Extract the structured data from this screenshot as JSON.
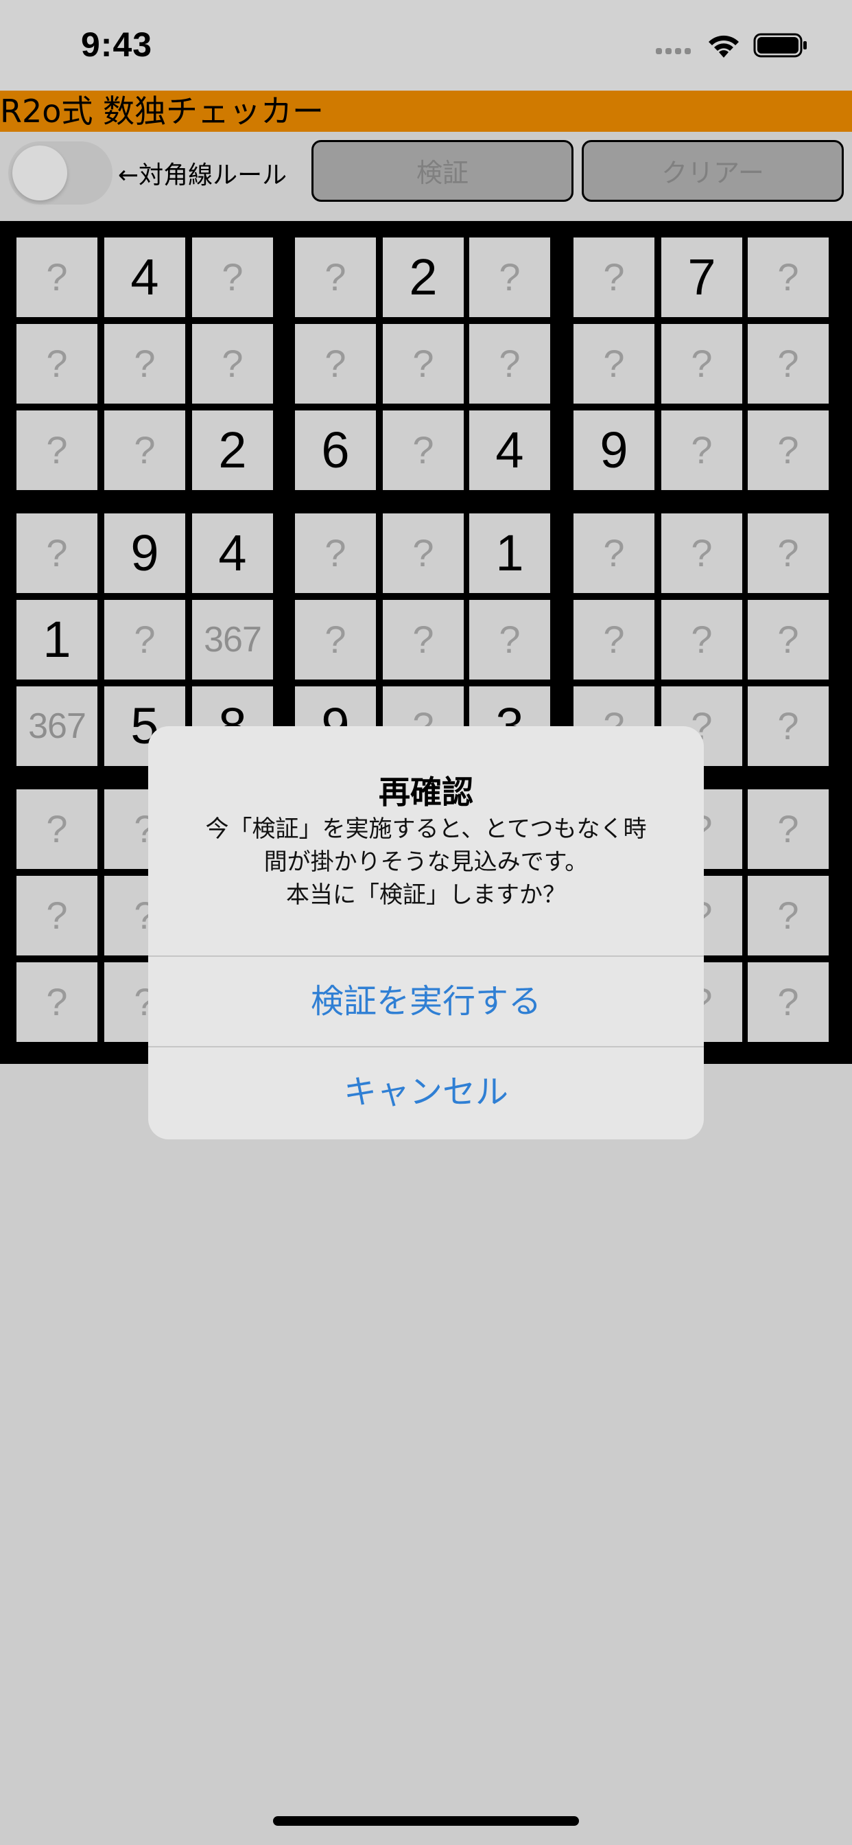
{
  "status_bar": {
    "time": "9:43"
  },
  "header": {
    "title": "R2o式 数独チェッカー"
  },
  "toolbar": {
    "diagonal_label": "←対角線ルール",
    "verify_label": "検証",
    "clear_label": "クリアー"
  },
  "grid": {
    "rows": [
      [
        "?",
        "4",
        "?",
        "?",
        "2",
        "?",
        "?",
        "7",
        "?"
      ],
      [
        "?",
        "?",
        "?",
        "?",
        "?",
        "?",
        "?",
        "?",
        "?"
      ],
      [
        "?",
        "?",
        "2",
        "6",
        "?",
        "4",
        "9",
        "?",
        "?"
      ],
      [
        "?",
        "9",
        "4",
        "?",
        "?",
        "1",
        "?",
        "?",
        "?"
      ],
      [
        "1",
        "?",
        "367",
        "?",
        "?",
        "?",
        "?",
        "?",
        "?"
      ],
      [
        "367",
        "5",
        "8",
        "9",
        "?",
        "3",
        "?",
        "?",
        "?"
      ],
      [
        "?",
        "?",
        "",
        "",
        "",
        "",
        "",
        "?",
        "?"
      ],
      [
        "?",
        "?",
        "",
        "",
        "",
        "",
        "",
        "?",
        "?"
      ],
      [
        "?",
        "?",
        "",
        "",
        "",
        "",
        "",
        "?",
        "?"
      ]
    ]
  },
  "alert": {
    "title": "再確認",
    "message_lines": [
      "今「検証」を実施すると、とてつもなく時",
      "間が掛かりそうな見込みです。",
      "本当に「検証」しますか？"
    ],
    "confirm_label": "検証を実行する",
    "cancel_label": "キャンセル"
  },
  "colors": {
    "header": "#d07a00",
    "alert_button": "#2f7fd4"
  }
}
